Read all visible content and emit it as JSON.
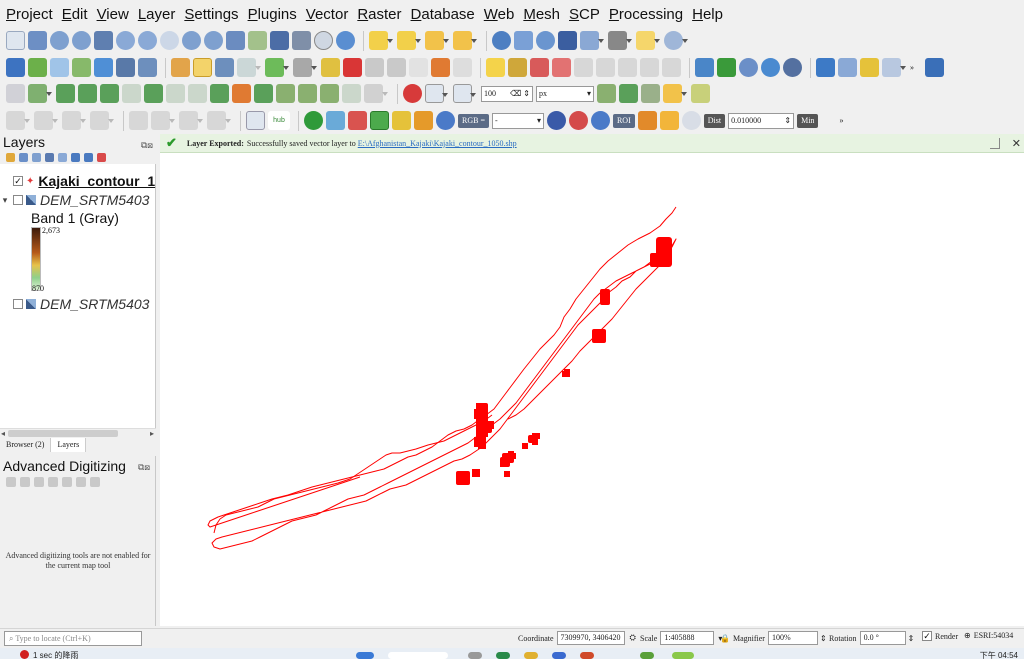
{
  "menu": [
    "Project",
    "Edit",
    "View",
    "Layer",
    "Settings",
    "Plugins",
    "Vector",
    "Raster",
    "Database",
    "Web",
    "Mesh",
    "SCP",
    "Processing",
    "Help"
  ],
  "toolbar": {
    "snap_tolerance": "100",
    "snap_unit": "px",
    "rgb_label": "RGB =",
    "rgb_value": "-",
    "roi_label": "ROI",
    "dist_label": "Dist",
    "dist_value": "0.010000",
    "min_label": "Min",
    "hub_label": "hub"
  },
  "layers_panel": {
    "title": "Layers",
    "layers": [
      {
        "name": "Kajaki_contour_1",
        "checked": "✓"
      },
      {
        "name": "DEM_SRTM5403",
        "checked": ""
      },
      {
        "name": "DEM_SRTM5403",
        "checked": ""
      }
    ],
    "band_label": "Band 1 (Gray)",
    "ramp_max": "2,673",
    "ramp_min": "870",
    "tabs": [
      "Browser (2)",
      "Layers"
    ]
  },
  "adv_digitizing": {
    "title": "Advanced Digitizing",
    "message": "Advanced digitizing tools are not enabled for the current map tool"
  },
  "message_bar": {
    "title": "Layer Exported:",
    "text": "Successfully saved vector layer to",
    "link": "E:\\Afghanistan_Kajaki\\Kajaki_contour_1050.shp"
  },
  "status_bar": {
    "locator_placeholder": "Type to locate (Ctrl+K)",
    "coordinate_label": "Coordinate",
    "coordinate_value": "7309970, 3406420",
    "scale_label": "Scale",
    "scale_value": "1:405888",
    "magnifier_label": "Magnifier",
    "magnifier_value": "100%",
    "rotation_label": "Rotation",
    "rotation_value": "0.0 °",
    "render_label": "Render",
    "crs": "ESRI:54034"
  },
  "taskbar": {
    "notification": "1 sec 的降雨",
    "time": "下午 04:54"
  },
  "colors": {
    "contour": "#ff0000",
    "message_bg": "#e7f3e1",
    "link": "#2a6cc2"
  }
}
